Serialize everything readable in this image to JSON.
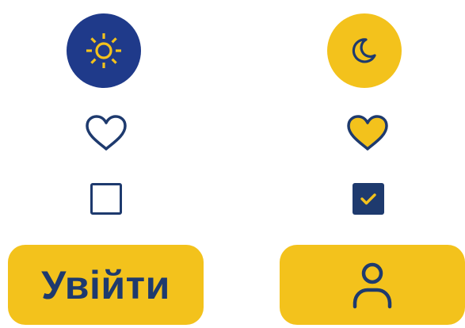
{
  "theme_toggles": {
    "light": {
      "icon": "sun-icon",
      "background": "#1f3a8a",
      "icon_color": "#f3c21c"
    },
    "dark": {
      "icon": "moon-icon",
      "background": "#f3c21c",
      "icon_color": "#1e3a6e"
    }
  },
  "favorites": {
    "inactive": {
      "icon": "heart-outline-icon",
      "stroke": "#1e3a6e"
    },
    "active": {
      "icon": "heart-filled-icon",
      "fill": "#f3c21c",
      "stroke": "#1e3a6e"
    }
  },
  "checkboxes": {
    "unchecked": {
      "checked": false
    },
    "checked": {
      "checked": true,
      "check_color": "#f3c21c"
    }
  },
  "buttons": {
    "login": {
      "label": "Увійти"
    },
    "profile": {
      "icon": "user-icon"
    }
  },
  "colors": {
    "primary_blue": "#1e3a6e",
    "accent_yellow": "#f3c21c"
  }
}
